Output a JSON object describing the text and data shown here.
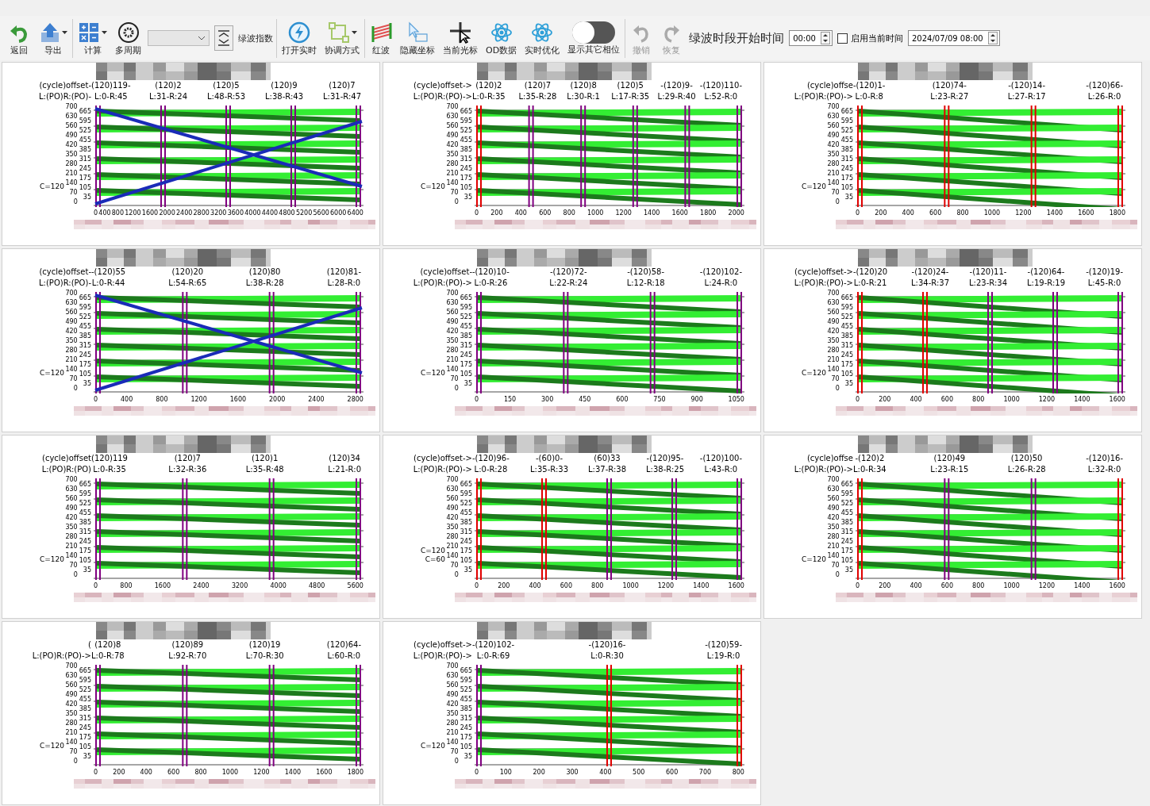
{
  "toolbar_groups": [
    [
      {
        "kind": "button",
        "label": "返回",
        "menu": false
      },
      {
        "kind": "button",
        "label": "导出",
        "menu": true
      }
    ],
    [
      {
        "kind": "button",
        "label": "计算",
        "menu": true
      },
      {
        "kind": "button",
        "label": "多周期",
        "menu": false
      },
      {
        "kind": "dropdown"
      },
      {
        "kind": "spinner"
      },
      {
        "kind": "label",
        "label": "绿波指数"
      }
    ],
    [
      {
        "kind": "button",
        "label": "打开实时",
        "menu": false
      },
      {
        "kind": "button",
        "label": "协调方式",
        "menu": true
      }
    ],
    [
      {
        "kind": "button",
        "label": "红波",
        "menu": false
      },
      {
        "kind": "button",
        "label": "隐藏坐标",
        "menu": false
      },
      {
        "kind": "button",
        "label": "当前光标",
        "menu": false
      },
      {
        "kind": "button",
        "label": "OD数据",
        "menu": false
      },
      {
        "kind": "button",
        "label": "实时优化",
        "menu": false
      },
      {
        "kind": "toggle",
        "label": "显示其它相位",
        "on": false
      }
    ],
    [
      {
        "kind": "button",
        "label": "撤销",
        "menu": false,
        "disabled": true
      },
      {
        "kind": "button",
        "label": "恢复",
        "menu": false,
        "disabled": true
      },
      {
        "kind": "title",
        "label": "绿波时段开始时间"
      },
      {
        "kind": "time",
        "value": "00:00"
      },
      {
        "kind": "checkbox",
        "label": "启用当前时间",
        "checked": false
      },
      {
        "kind": "time",
        "value": "2024/07/09 08:00"
      }
    ]
  ],
  "panels": [
    {
      "offset_caption": "(cycle)offset-",
      "po_caption": "L:(PO)R:(PO)-",
      "trajectories": true,
      "cycle_labels": [
        "C=120"
      ],
      "y_ticks": [
        "700",
        "665",
        "630",
        "595",
        "560",
        "525",
        "490",
        "455",
        "420",
        "385",
        "350",
        "315",
        "280",
        "245",
        "210",
        "175",
        "140",
        "105",
        "70",
        "35",
        "0"
      ],
      "intersections": [
        {
          "offset": "(120)119-",
          "lr": "L:0-R:45",
          "color": "#800080"
        },
        {
          "offset": "(120)2",
          "lr": "L:31-R:24",
          "color": "#800080"
        },
        {
          "offset": "(120)5",
          "lr": "L:48-R:53",
          "color": "#800080"
        },
        {
          "offset": "(120)9",
          "lr": "L:38-R:43",
          "color": "#800080"
        },
        {
          "offset": "(120)7",
          "lr": "L:31-R:47",
          "color": "#800080"
        }
      ],
      "x_ticks": [
        "0",
        "400",
        "800",
        "1200",
        "1600",
        "2000",
        "2400",
        "2800",
        "3200",
        "3600",
        "4000",
        "4400",
        "4800",
        "5200",
        "5600",
        "6000",
        "6400"
      ]
    },
    {
      "offset_caption": "(cycle)offset->",
      "po_caption": "L:(PO)R:(PO)->",
      "trajectories": false,
      "cycle_labels": [
        "C=120"
      ],
      "y_ticks": [
        "700",
        "665",
        "630",
        "595",
        "560",
        "525",
        "490",
        "455",
        "420",
        "385",
        "350",
        "315",
        "280",
        "245",
        "210",
        "175",
        "140",
        "105",
        "70",
        "35",
        "0"
      ],
      "intersections": [
        {
          "offset": "(120)2",
          "lr": "L:0-R:35",
          "color": "#e00000"
        },
        {
          "offset": "(120)7",
          "lr": "L:35-R:28",
          "color": "#800080"
        },
        {
          "offset": "(120)8",
          "lr": "L:30-R:1",
          "color": "#800080"
        },
        {
          "offset": "(120)5",
          "lr": "L:17-R:35",
          "color": "#800080"
        },
        {
          "offset": "-(120)9-",
          "lr": "L:29-R:40",
          "color": "#800080"
        },
        {
          "offset": "-(120)110-",
          "lr": "L:52-R:0",
          "color": "#800080"
        }
      ],
      "x_ticks": [
        "0",
        "200",
        "400",
        "600",
        "800",
        "1000",
        "1200",
        "1400",
        "1600",
        "1800",
        "2000"
      ]
    },
    {
      "offset_caption": "(cycle)offse",
      "po_caption": "L:(PO)R:(PO)->",
      "trajectories": false,
      "cycle_labels": [
        "C=120"
      ],
      "y_ticks": [
        "700",
        "665",
        "630",
        "595",
        "560",
        "525",
        "490",
        "455",
        "420",
        "385",
        "350",
        "315",
        "280",
        "245",
        "210",
        "175",
        "140",
        "105",
        "70",
        "35",
        "0"
      ],
      "intersections": [
        {
          "offset": "-(120)1-",
          "lr": "L:0-R:8",
          "color": "#e00000"
        },
        {
          "offset": "(120)74-",
          "lr": "L:23-R:27",
          "color": "#e00000"
        },
        {
          "offset": "-(120)14-",
          "lr": "L:27-R:17",
          "color": "#e00000"
        },
        {
          "offset": "-(120)66-",
          "lr": "L:26-R:0",
          "color": "#e00000"
        }
      ],
      "x_ticks": [
        "0",
        "200",
        "400",
        "600",
        "800",
        "1000",
        "1200",
        "1400",
        "1600",
        "1800"
      ]
    },
    {
      "offset_caption": "(cycle)offset-",
      "po_caption": "L:(PO)R:(PO)-",
      "trajectories": true,
      "cycle_labels": [
        "C=120"
      ],
      "y_ticks": [
        "700",
        "665",
        "630",
        "595",
        "560",
        "525",
        "490",
        "455",
        "420",
        "385",
        "350",
        "315",
        "280",
        "245",
        "210",
        "175",
        "140",
        "105",
        "70",
        "35",
        "0"
      ],
      "intersections": [
        {
          "offset": "-(120)55",
          "lr": "L:0-R:44",
          "color": "#800080"
        },
        {
          "offset": "(120)20",
          "lr": "L:54-R:65",
          "color": "#800080"
        },
        {
          "offset": "(120)80",
          "lr": "L:38-R:28",
          "color": "#800080"
        },
        {
          "offset": "(120)81-",
          "lr": "L:28-R:0",
          "color": "#800080"
        }
      ],
      "x_ticks": [
        "0",
        "400",
        "800",
        "1200",
        "1600",
        "2000",
        "2400",
        "2800"
      ]
    },
    {
      "offset_caption": "(cycle)offset-",
      "po_caption": "L:(PO)R:(PO)->",
      "trajectories": false,
      "cycle_labels": [
        "C=120"
      ],
      "y_ticks": [
        "700",
        "665",
        "630",
        "595",
        "560",
        "525",
        "490",
        "455",
        "420",
        "385",
        "350",
        "315",
        "280",
        "245",
        "210",
        "175",
        "140",
        "105",
        "70",
        "35",
        "0"
      ],
      "intersections": [
        {
          "offset": "-(120)10-",
          "lr": "L:0-R:26",
          "color": "#800080"
        },
        {
          "offset": "-(120)72-",
          "lr": "L:22-R:24",
          "color": "#800080"
        },
        {
          "offset": "-(120)58-",
          "lr": "L:12-R:18",
          "color": "#800080"
        },
        {
          "offset": "-(120)102-",
          "lr": "L:24-R:0",
          "color": "#800080"
        }
      ],
      "x_ticks": [
        "0",
        "150",
        "300",
        "450",
        "600",
        "750",
        "900",
        "1050"
      ]
    },
    {
      "offset_caption": "(cycle)offset->",
      "po_caption": "L:(PO)R:(PO)->",
      "trajectories": false,
      "cycle_labels": [
        "C=120"
      ],
      "y_ticks": [
        "700",
        "665",
        "630",
        "595",
        "560",
        "525",
        "490",
        "455",
        "420",
        "385",
        "350",
        "315",
        "280",
        "245",
        "210",
        "175",
        "140",
        "105",
        "70",
        "35",
        "0"
      ],
      "intersections": [
        {
          "offset": "-(120)20",
          "lr": "L:0-R:21",
          "color": "#e00000"
        },
        {
          "offset": "-(120)24-",
          "lr": "L:34-R:37",
          "color": "#e00000"
        },
        {
          "offset": "-(120)11-",
          "lr": "L:23-R:34",
          "color": "#800080"
        },
        {
          "offset": "-(120)64-",
          "lr": "L:19-R:19",
          "color": "#800080"
        },
        {
          "offset": "-(120)19-",
          "lr": "L:45-R:0",
          "color": "#800080"
        }
      ],
      "x_ticks": [
        "0",
        "200",
        "400",
        "600",
        "800",
        "1000",
        "1200",
        "1400",
        "1600"
      ]
    },
    {
      "offset_caption": "(cycle)offset",
      "po_caption": "L:(PO)R:(PO)",
      "trajectories": false,
      "cycle_labels": [
        "C=120"
      ],
      "y_ticks": [
        "700",
        "665",
        "630",
        "595",
        "560",
        "525",
        "490",
        "455",
        "420",
        "385",
        "350",
        "315",
        "280",
        "245",
        "210",
        "175",
        "140",
        "105",
        "70",
        "35",
        "0"
      ],
      "intersections": [
        {
          "offset": "(120)119",
          "lr": "L:0-R:35",
          "color": "#800080"
        },
        {
          "offset": "(120)7",
          "lr": "L:32-R:36",
          "color": "#800080"
        },
        {
          "offset": "(120)1",
          "lr": "L:35-R:48",
          "color": "#800080"
        },
        {
          "offset": "(120)34",
          "lr": "L:21-R:0",
          "color": "#800080"
        }
      ],
      "x_ticks": [
        "0",
        "800",
        "1600",
        "2400",
        "3200",
        "4000",
        "4800",
        "5600"
      ]
    },
    {
      "offset_caption": "(cycle)offset->",
      "po_caption": "L:(PO)R:(PO)->",
      "trajectories": false,
      "cycle_labels": [
        "C=120",
        "C=60"
      ],
      "y_ticks": [
        "700",
        "665",
        "630",
        "595",
        "560",
        "525",
        "490",
        "455",
        "420",
        "385",
        "350",
        "315",
        "280",
        "245",
        "210",
        "175",
        "140",
        "105",
        "70",
        "35",
        "0"
      ],
      "intersections": [
        {
          "offset": "-(120)96-",
          "lr": "L:0-R:28",
          "color": "#e00000"
        },
        {
          "offset": "-(60)0-",
          "lr": "L:35-R:33",
          "color": "#e00000"
        },
        {
          "offset": "(60)33",
          "lr": "L:37-R:38",
          "color": "#800080"
        },
        {
          "offset": "-(120)95-",
          "lr": "L:38-R:25",
          "color": "#800080"
        },
        {
          "offset": "-(120)100-",
          "lr": "L:43-R:0",
          "color": "#800080"
        }
      ],
      "x_ticks": [
        "0",
        "200",
        "400",
        "600",
        "800",
        "1000",
        "1200",
        "1400",
        "1600"
      ]
    },
    {
      "offset_caption": "(cycle)offse",
      "po_caption": "L:(PO)R:(PO)->",
      "trajectories": false,
      "cycle_labels": [
        "C=120"
      ],
      "y_ticks": [
        "700",
        "665",
        "630",
        "595",
        "560",
        "525",
        "490",
        "455",
        "420",
        "385",
        "350",
        "315",
        "280",
        "245",
        "210",
        "175",
        "140",
        "105",
        "70",
        "35",
        "0"
      ],
      "intersections": [
        {
          "offset": "-(120)2",
          "lr": "L:0-R:34",
          "color": "#e00000"
        },
        {
          "offset": "(120)49",
          "lr": "L:23-R:15",
          "color": "#800080"
        },
        {
          "offset": "(120)50",
          "lr": "L:26-R:28",
          "color": "#800080"
        },
        {
          "offset": "-(120)16-",
          "lr": "L:32-R:0",
          "color": "#e00000"
        }
      ],
      "x_ticks": [
        "0",
        "200",
        "400",
        "600",
        "800",
        "1000",
        "1200",
        "1400",
        "1600"
      ]
    },
    {
      "offset_caption": "(",
      "po_caption": "L:(PO)R:(PO)->",
      "trajectories": false,
      "cycle_labels": [
        "C=120"
      ],
      "y_ticks": [
        "700",
        "665",
        "630",
        "595",
        "560",
        "525",
        "490",
        "455",
        "420",
        "385",
        "350",
        "315",
        "280",
        "245",
        "210",
        "175",
        "140",
        "105",
        "70",
        "35",
        "0"
      ],
      "intersections": [
        {
          "offset": "(120)8",
          "lr": "L:0-R:78",
          "color": "#800080"
        },
        {
          "offset": "(120)89",
          "lr": "L:92-R:70",
          "color": "#800080"
        },
        {
          "offset": "(120)19",
          "lr": "L:70-R:30",
          "color": "#800080"
        },
        {
          "offset": "(120)64-",
          "lr": "L:60-R:0",
          "color": "#800080"
        }
      ],
      "x_ticks": [
        "0",
        "200",
        "400",
        "600",
        "800",
        "1000",
        "1200",
        "1400",
        "1600",
        "1800"
      ]
    },
    {
      "offset_caption": "(cycle)offset->",
      "po_caption": "L:(PO)R:(PO)->",
      "trajectories": false,
      "cycle_labels": [
        "C=120"
      ],
      "y_ticks": [
        "700",
        "665",
        "630",
        "595",
        "560",
        "525",
        "490",
        "455",
        "420",
        "385",
        "350",
        "315",
        "280",
        "245",
        "210",
        "175",
        "140",
        "105",
        "70",
        "35",
        "0"
      ],
      "intersections": [
        {
          "offset": "-(120)102-",
          "lr": "L:0-R:69",
          "color": "#800080"
        },
        {
          "offset": "-(120)16-",
          "lr": "L:0-R:30",
          "color": "#e00000"
        },
        {
          "offset": "-(120)59-",
          "lr": "L:19-R:0",
          "color": "#e00000"
        }
      ],
      "x_ticks": [
        "0",
        "100",
        "200",
        "300",
        "400",
        "500",
        "600",
        "700",
        "800"
      ]
    }
  ]
}
